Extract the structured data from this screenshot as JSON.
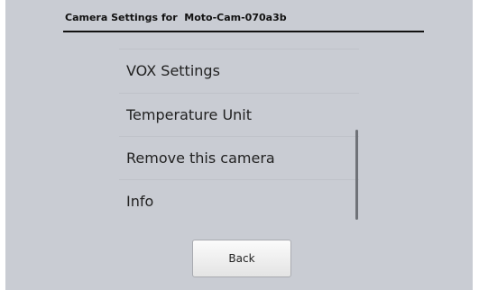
{
  "header": {
    "title": "Camera Settings for  Moto-Cam-070a3b"
  },
  "settings_list": {
    "items": [
      {
        "label": "VOX Settings"
      },
      {
        "label": "Temperature Unit"
      },
      {
        "label": "Remove this camera"
      },
      {
        "label": "Info"
      }
    ]
  },
  "footer": {
    "back_label": "Back"
  }
}
